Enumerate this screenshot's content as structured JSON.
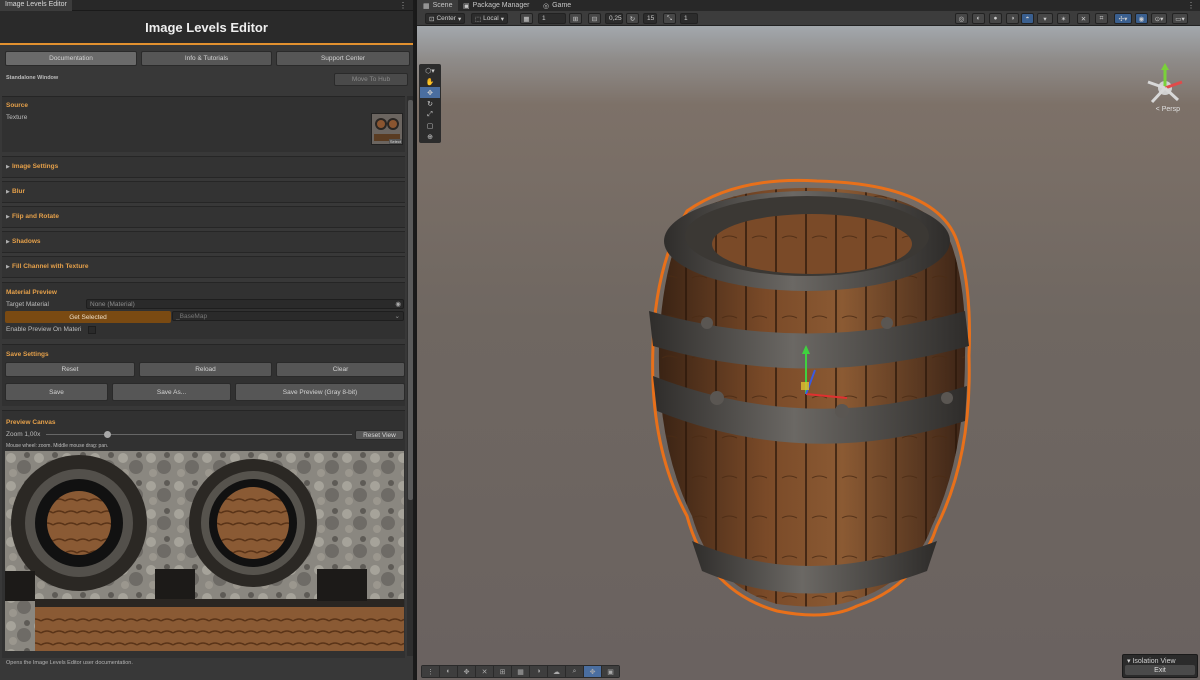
{
  "left_tab": {
    "title": "Image Levels Editor",
    "menu": "⋮"
  },
  "editor": {
    "title": "Image Levels Editor",
    "links": [
      "Documentation",
      "Info & Tutorials",
      "Support Center"
    ],
    "window_mode": "Standalone Window",
    "move_to_hub": "Move To Hub"
  },
  "source": {
    "title": "Source",
    "texture_label": "Texture",
    "select_label": "Select"
  },
  "foldouts": [
    "Image Settings",
    "Blur",
    "Flip and Rotate",
    "Shadows",
    "Fill Channel with Texture"
  ],
  "material_preview": {
    "title": "Material Preview",
    "target_label": "Target Material",
    "target_value": "None (Material)",
    "get_selected": "Get Selected",
    "basemap": "_BaseMap",
    "enable_label": "Enable Preview On Materi"
  },
  "save_settings": {
    "title": "Save Settings",
    "row1": [
      "Reset",
      "Reload",
      "Clear"
    ],
    "row2": [
      "Save",
      "Save As...",
      "Save Preview (Gray 8-bit)"
    ]
  },
  "preview_canvas": {
    "title": "Preview Canvas",
    "zoom_label": "Zoom 1,00x",
    "zoom_value": 0.2,
    "reset_view": "Reset View",
    "hint": "Mouse wheel: zoom. Middle mouse drag: pan."
  },
  "status": "Opens the Image Levels Editor user documentation.",
  "scene_tabs": [
    {
      "label": "Scene",
      "icon": "grid-icon"
    },
    {
      "label": "Package Manager",
      "icon": "package-icon"
    },
    {
      "label": "Game",
      "icon": "gamepad-icon"
    }
  ],
  "toolbar": {
    "pivot": "Center",
    "space": "Local",
    "grid_value": "1",
    "snap_value": "0,25",
    "rotate_snap": "15",
    "scale_snap": "1"
  },
  "persp_label": "< Persp",
  "isolation": {
    "title": "Isolation View",
    "exit": "Exit"
  },
  "colors": {
    "accent": "#e2912f",
    "section_title": "#e5a04a",
    "selected_button": "#7a4a12",
    "outline": "#e8701a"
  }
}
